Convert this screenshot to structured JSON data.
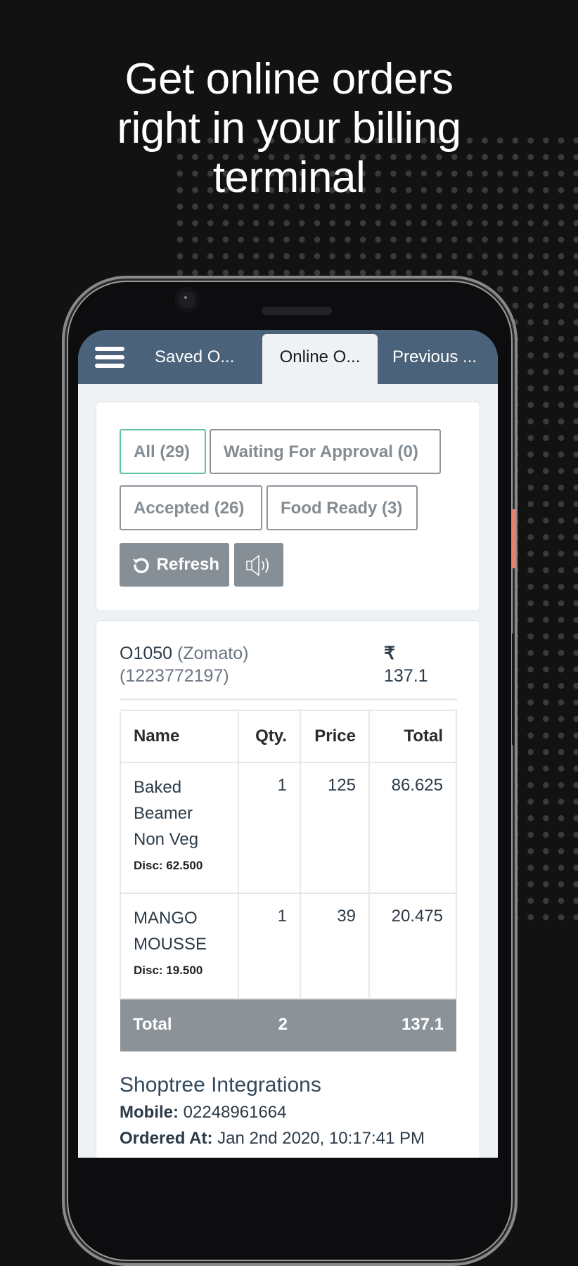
{
  "promo": {
    "headline_lines": [
      "Get online orders",
      "right in your billing",
      "terminal"
    ]
  },
  "app": {
    "menu_icon": "hamburger-menu-icon",
    "tabs": [
      {
        "label": "Saved O...",
        "active": false
      },
      {
        "label": "Online O...",
        "active": true
      },
      {
        "label": "Previous ...",
        "active": false
      }
    ]
  },
  "filters": {
    "buttons": [
      {
        "label": "All (29)",
        "active": true
      },
      {
        "label": "Waiting For Approval (0)",
        "active": false
      },
      {
        "label": "Accepted (26)",
        "active": false
      },
      {
        "label": "Food Ready (3)",
        "active": false
      }
    ],
    "refresh_label": "Refresh",
    "refresh_icon": "refresh-icon",
    "sound_icon": "speaker-icon"
  },
  "order": {
    "id": "O1050",
    "source": "(Zomato)",
    "external_id": "(1223772197)",
    "currency_symbol": "₹",
    "amount": "137.1",
    "columns": [
      "Name",
      "Qty.",
      "Price",
      "Total"
    ],
    "items": [
      {
        "name": "Baked Beamer Non Veg",
        "disc": "Disc: 62.500",
        "qty": "1",
        "price": "125",
        "total": "86.625"
      },
      {
        "name": "MANGO MOUSSE",
        "disc": "Disc: 19.500",
        "qty": "1",
        "price": "39",
        "total": "20.475"
      }
    ],
    "total_row": {
      "label": "Total",
      "qty": "2",
      "amount": "137.1"
    }
  },
  "customer": {
    "name": "Shoptree Integrations",
    "mobile_label": "Mobile:",
    "mobile": "02248961664",
    "ordered_at_label": "Ordered At:",
    "ordered_at": "Jan 2nd 2020, 10:17:41 PM"
  },
  "colors": {
    "topbar": "#4a627a",
    "active_filter_border": "#5fc2a0",
    "action_button": "#868e96",
    "side_button": "#e8806a"
  }
}
